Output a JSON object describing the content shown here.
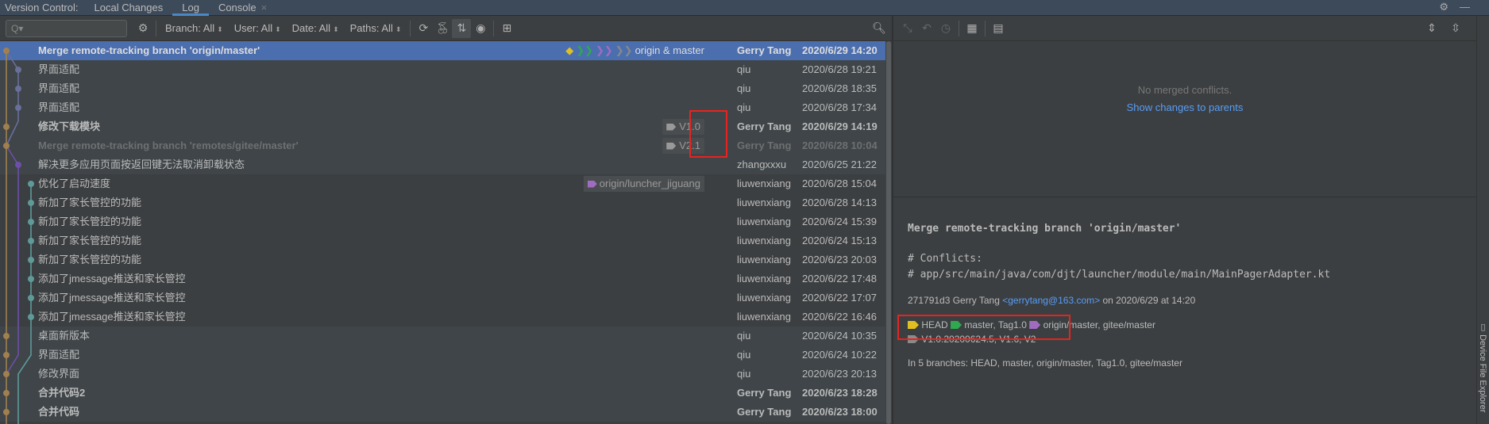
{
  "tabbar": {
    "label": "Version Control:",
    "tabs": [
      {
        "label": "Local Changes"
      },
      {
        "label": "Log"
      },
      {
        "label": "Console"
      }
    ],
    "close": "×"
  },
  "toolbar": {
    "search_placeholder": "Q▾",
    "filters": [
      {
        "label": "Branch: All"
      },
      {
        "label": "User: All"
      },
      {
        "label": "Date: All"
      },
      {
        "label": "Paths: All"
      }
    ]
  },
  "commits": [
    {
      "message": "Merge remote-tracking branch 'origin/master'",
      "author": "Gerry Tang",
      "date": "2020/6/29 14:20",
      "refs": "origin & master",
      "style": "sel bold"
    },
    {
      "message": "界面适配",
      "author": "qiu",
      "date": "2020/6/28 19:21",
      "style": "b1"
    },
    {
      "message": "界面适配",
      "author": "qiu",
      "date": "2020/6/28 18:35",
      "style": "b1"
    },
    {
      "message": "界面适配",
      "author": "qiu",
      "date": "2020/6/28 17:34",
      "style": "b1"
    },
    {
      "message": "修改下载模块",
      "author": "Gerry Tang",
      "date": "2020/6/29 14:19",
      "tag": "V1.0",
      "style": "b1 bold"
    },
    {
      "message": "Merge remote-tracking branch 'remotes/gitee/master'",
      "author": "Gerry Tang",
      "date": "2020/6/28 10:04",
      "tag": "V2.1",
      "style": "b1 bold dim"
    },
    {
      "message": "解决更多应用页面按返回键无法取消卸载状态",
      "author": "zhangxxxu",
      "date": "2020/6/25 21:22",
      "style": "b1"
    },
    {
      "message": "优化了启动速度",
      "author": "liuwenxiang",
      "date": "2020/6/28 15:04",
      "refs": "origin/luncher_jiguang",
      "style": "b2"
    },
    {
      "message": "新加了家长管控的功能",
      "author": "liuwenxiang",
      "date": "2020/6/28 14:13",
      "style": "b2"
    },
    {
      "message": "新加了家长管控的功能",
      "author": "liuwenxiang",
      "date": "2020/6/24 15:39",
      "style": "b2"
    },
    {
      "message": "新加了家长管控的功能",
      "author": "liuwenxiang",
      "date": "2020/6/24 15:13",
      "style": "b2"
    },
    {
      "message": "新加了家长管控的功能",
      "author": "liuwenxiang",
      "date": "2020/6/23 20:03",
      "style": "b2"
    },
    {
      "message": "添加了jmessage推送和家长管控",
      "author": "liuwenxiang",
      "date": "2020/6/22 17:48",
      "style": "b2"
    },
    {
      "message": "添加了jmessage推送和家长管控",
      "author": "liuwenxiang",
      "date": "2020/6/22 17:07",
      "style": "b2"
    },
    {
      "message": "添加了jmessage推送和家长管控",
      "author": "liuwenxiang",
      "date": "2020/6/22 16:46",
      "style": "b2"
    },
    {
      "message": "桌面新版本",
      "author": "qiu",
      "date": "2020/6/24 10:35",
      "style": "b1"
    },
    {
      "message": "界面适配",
      "author": "qiu",
      "date": "2020/6/24 10:22",
      "style": "b1"
    },
    {
      "message": "修改界面",
      "author": "qiu",
      "date": "2020/6/23 20:13",
      "style": "b1"
    },
    {
      "message": "合并代码2",
      "author": "Gerry Tang",
      "date": "2020/6/23 18:28",
      "style": "b1 bold"
    },
    {
      "message": "合并代码",
      "author": "Gerry Tang",
      "date": "2020/6/23 18:00",
      "style": "b1 bold"
    }
  ],
  "changes": {
    "empty": "No merged conflicts.",
    "link": "Show changes to parents"
  },
  "details": {
    "subject": "Merge remote-tracking branch 'origin/master'",
    "conflicts_header": "# Conflicts:",
    "conflict_file": "# app/src/main/java/com/djt/launcher/module/main/MainPagerAdapter.kt",
    "hash_author": "271791d3 Gerry Tang",
    "email": "<gerrytang@163.com>",
    "date": "on 2020/6/29 at 14:20",
    "head": "HEAD",
    "local": "master, Tag1.0",
    "remote": "origin/master, gitee/master",
    "tags": "V1.0.20200624.5, V1.6, V2",
    "branches": "In 5 branches: HEAD, master, origin/master, Tag1.0, gitee/master"
  },
  "side": {
    "device_explorer": "Device File Explorer"
  },
  "colors": {
    "selection": "#4b6eaf",
    "link": "#589df6",
    "lane_main": "#a08050",
    "lane_blue": "#6a6f9a",
    "lane_purple": "#6d4fa8",
    "lane_teal": "#5f9a9a",
    "annotation": "#e8231f"
  }
}
